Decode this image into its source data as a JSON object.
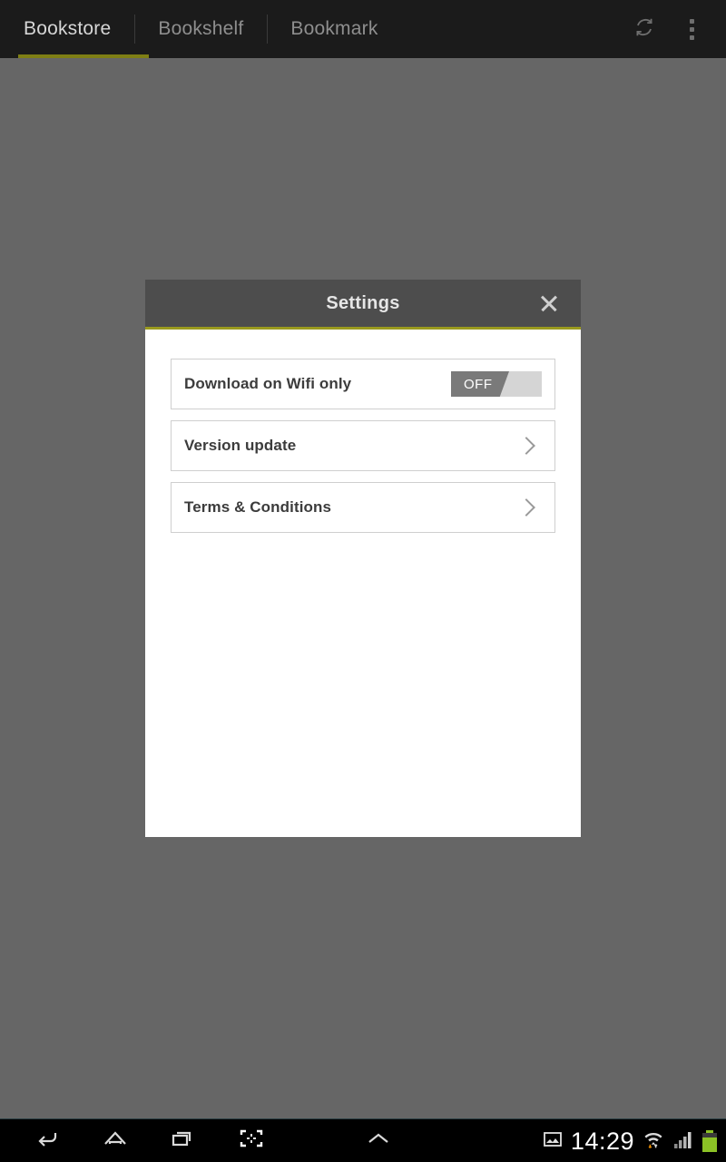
{
  "appbar": {
    "tabs": [
      {
        "label": "Bookstore",
        "active": true
      },
      {
        "label": "Bookshelf",
        "active": false
      },
      {
        "label": "Bookmark",
        "active": false
      }
    ],
    "actions": [
      {
        "name": "refresh-icon",
        "label": "Refresh"
      },
      {
        "name": "overflow-menu-icon",
        "label": "More options"
      }
    ],
    "active_tab_accent": "#7e7e14",
    "background": "#1b1b1b"
  },
  "dialog": {
    "title": "Settings",
    "close_label": "Close",
    "accent_color": "#9a9a1e",
    "header_background": "#4d4d4d",
    "body_background": "#ffffff",
    "rows": [
      {
        "label": "Download on Wifi only",
        "control": "toggle",
        "toggle_value": "OFF",
        "toggle_state": false
      },
      {
        "label": "Version update",
        "control": "chevron"
      },
      {
        "label": "Terms & Conditions",
        "control": "chevron"
      }
    ]
  },
  "scrim_color": "#666666",
  "systembar": {
    "nav_keys": [
      {
        "name": "back-icon",
        "label": "Back"
      },
      {
        "name": "home-icon",
        "label": "Home"
      },
      {
        "name": "recent-apps-icon",
        "label": "Recent apps"
      },
      {
        "name": "screenshot-icon",
        "label": "Screenshot"
      },
      {
        "name": "chevron-up-icon",
        "label": "Show more"
      }
    ],
    "status": {
      "screenshot_notification": "image-icon",
      "clock": "14:29",
      "wifi": "wifi-icon",
      "signal": "cellular-signal-icon",
      "battery": "battery-full-icon",
      "battery_color": "#8bc225"
    }
  }
}
